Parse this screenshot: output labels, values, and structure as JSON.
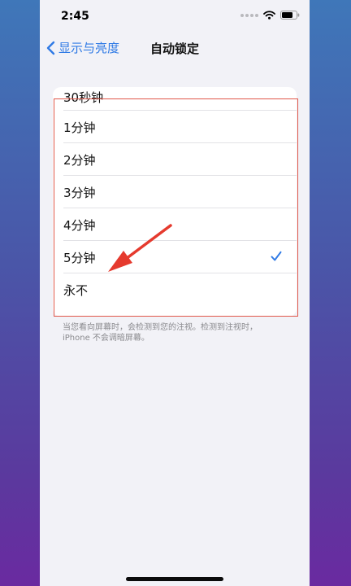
{
  "status_bar": {
    "time": "2:45",
    "icons": [
      "signal-dots-icon",
      "wifi-icon",
      "battery-icon"
    ]
  },
  "nav": {
    "back_label": "显示与亮度",
    "title": "自动锁定"
  },
  "options": [
    {
      "label": "30秒钟",
      "selected": false
    },
    {
      "label": "1分钟",
      "selected": false
    },
    {
      "label": "2分钟",
      "selected": false
    },
    {
      "label": "3分钟",
      "selected": false
    },
    {
      "label": "4分钟",
      "selected": false
    },
    {
      "label": "5分钟",
      "selected": true
    },
    {
      "label": "永不",
      "selected": false
    }
  ],
  "footnote": "当您看向屏幕时，会检测到您的注视。检测到注视时，iPhone 不会调暗屏幕。",
  "colors": {
    "accent": "#2f7ae5",
    "highlight_box": "#e0574a",
    "arrow": "#e53a2e"
  }
}
